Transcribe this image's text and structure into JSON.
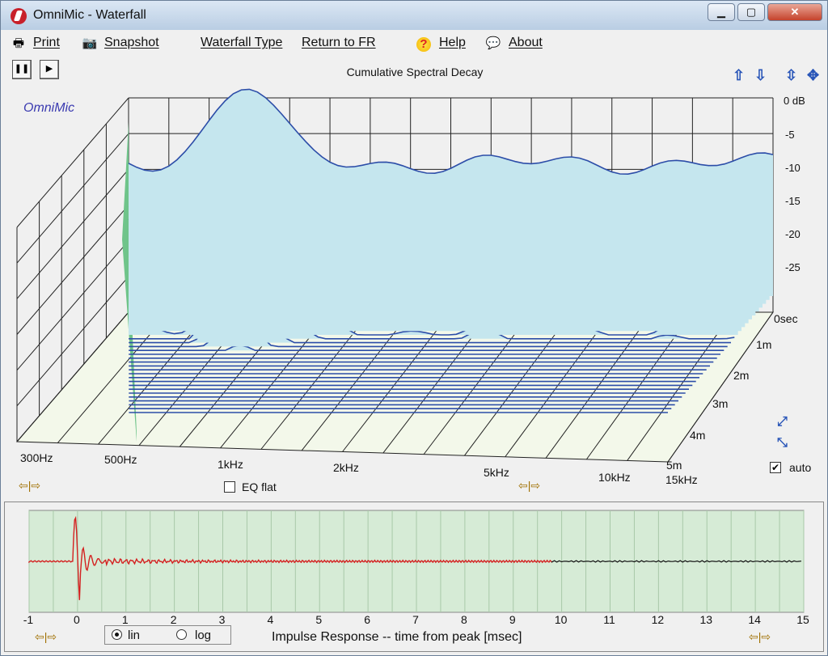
{
  "window": {
    "title": "OmniMic - Waterfall",
    "min_label": "▁",
    "max_label": "▢",
    "close_label": "✕"
  },
  "menu": {
    "print": "Print",
    "snapshot": "Snapshot",
    "waterfall_type": "Waterfall Type",
    "return_fr": "Return to FR",
    "help": "Help",
    "about": "About"
  },
  "toolbar": {
    "pause_glyph": "❚❚",
    "play_glyph": "▶"
  },
  "waterfall": {
    "title": "Cumulative Spectral Decay",
    "brand": "OmniMic",
    "db_ticks": [
      "0 dB",
      "-5",
      "-10",
      "-15",
      "-20",
      "-25"
    ],
    "time_ticks": [
      "0sec",
      "1m",
      "2m",
      "3m",
      "4m",
      "5m"
    ],
    "freq_ticks": [
      "300Hz",
      "500Hz",
      "1kHz",
      "2kHz",
      "5kHz",
      "10kHz",
      "15kHz"
    ],
    "eq_flat_label": "EQ flat",
    "eq_flat_checked": false,
    "auto_label": "auto",
    "auto_checked": true,
    "colors": {
      "surface_fill": "#c5e6ee",
      "line": "#2c4da8",
      "highlight": "#f5e21c",
      "side": "#6fc48a"
    }
  },
  "impulse": {
    "title": "Impulse Response  -- time from peak [msec]",
    "x_ticks": [
      "-1",
      "0",
      "1",
      "2",
      "3",
      "4",
      "5",
      "6",
      "7",
      "8",
      "9",
      "10",
      "11",
      "12",
      "13",
      "14",
      "15"
    ],
    "mode_options": [
      "lin",
      "log"
    ],
    "mode_selected": "lin",
    "colors": {
      "bg": "#d6ebd6",
      "trace": "#d42020",
      "trace_tail": "#111111",
      "grid": "#a8c8a8"
    }
  },
  "nav": {
    "left_right": "⇦|⇨"
  }
}
